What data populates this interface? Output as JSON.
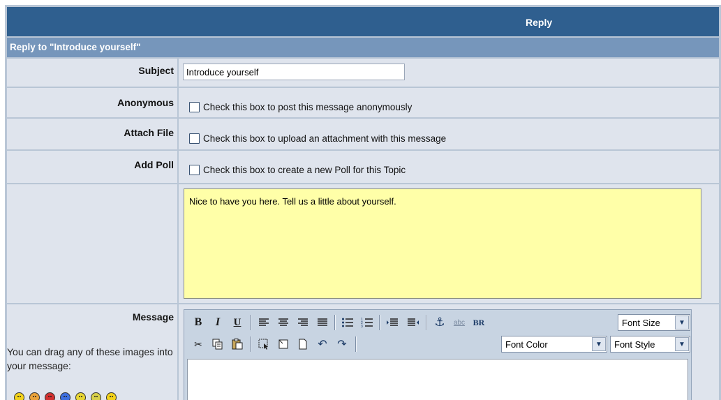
{
  "header": {
    "title": "Reply",
    "subtitle": "Reply to \"Introduce yourself\""
  },
  "form": {
    "subject_label": "Subject",
    "subject_value": "Introduce yourself",
    "anonymous_label": "Anonymous",
    "anonymous_text": "Check this box to post this message anonymously",
    "attach_label": "Attach File",
    "attach_text": "Check this box to upload an attachment with this message",
    "poll_label": "Add Poll",
    "poll_text": "Check this box to create a new Poll for this Topic",
    "preview_text": "Nice to have you here. Tell us a little about yourself.",
    "message_label": "Message",
    "drag_note": "You can drag any of these images into your message:"
  },
  "toolbar": {
    "bold": "B",
    "italic": "I",
    "underline": "U",
    "line_break": "BR",
    "font_size": "Font Size",
    "font_color": "Font Color",
    "font_style": "Font Style",
    "icons": [
      "bold-icon",
      "italic-icon",
      "underline-icon",
      "align-left-icon",
      "align-center-icon",
      "align-right-icon",
      "justify-icon",
      "bullet-list-icon",
      "numbered-list-icon",
      "indent-icon",
      "outdent-icon",
      "anchor-icon",
      "spellcheck-icon",
      "line-break-icon",
      "cut-icon",
      "copy-icon",
      "paste-icon",
      "select-all-icon",
      "new-box-icon",
      "new-document-icon",
      "undo-icon",
      "redo-icon"
    ]
  },
  "colors": {
    "header_bg": "#2f5f8f",
    "subheader_bg": "#7696bb",
    "cell_bg": "#dfe4ed",
    "preview_bg": "#ffffa8"
  },
  "smileys": [
    "#f2d21b",
    "#e9a23b",
    "#d23030",
    "#3d6fe0",
    "#e8d634",
    "#d8d04a",
    "#f2d21b"
  ]
}
